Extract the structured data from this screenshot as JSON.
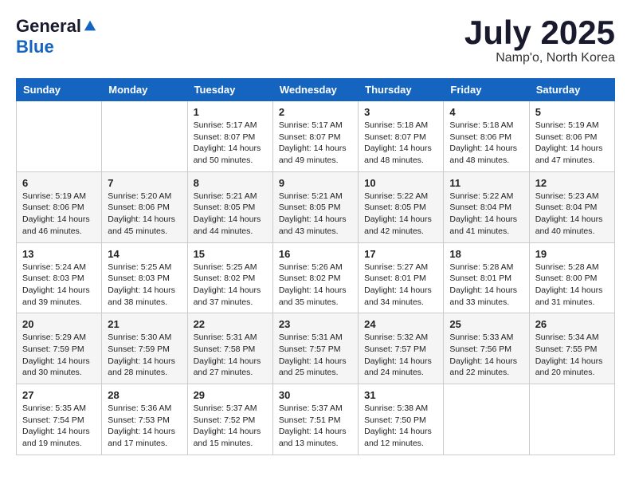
{
  "header": {
    "logo_line1": "General",
    "logo_line2": "Blue",
    "month_title": "July 2025",
    "location": "Namp'o, North Korea"
  },
  "weekdays": [
    "Sunday",
    "Monday",
    "Tuesday",
    "Wednesday",
    "Thursday",
    "Friday",
    "Saturday"
  ],
  "weeks": [
    [
      {
        "day": "",
        "content": ""
      },
      {
        "day": "",
        "content": ""
      },
      {
        "day": "1",
        "content": "Sunrise: 5:17 AM\nSunset: 8:07 PM\nDaylight: 14 hours and 50 minutes."
      },
      {
        "day": "2",
        "content": "Sunrise: 5:17 AM\nSunset: 8:07 PM\nDaylight: 14 hours and 49 minutes."
      },
      {
        "day": "3",
        "content": "Sunrise: 5:18 AM\nSunset: 8:07 PM\nDaylight: 14 hours and 48 minutes."
      },
      {
        "day": "4",
        "content": "Sunrise: 5:18 AM\nSunset: 8:06 PM\nDaylight: 14 hours and 48 minutes."
      },
      {
        "day": "5",
        "content": "Sunrise: 5:19 AM\nSunset: 8:06 PM\nDaylight: 14 hours and 47 minutes."
      }
    ],
    [
      {
        "day": "6",
        "content": "Sunrise: 5:19 AM\nSunset: 8:06 PM\nDaylight: 14 hours and 46 minutes."
      },
      {
        "day": "7",
        "content": "Sunrise: 5:20 AM\nSunset: 8:06 PM\nDaylight: 14 hours and 45 minutes."
      },
      {
        "day": "8",
        "content": "Sunrise: 5:21 AM\nSunset: 8:05 PM\nDaylight: 14 hours and 44 minutes."
      },
      {
        "day": "9",
        "content": "Sunrise: 5:21 AM\nSunset: 8:05 PM\nDaylight: 14 hours and 43 minutes."
      },
      {
        "day": "10",
        "content": "Sunrise: 5:22 AM\nSunset: 8:05 PM\nDaylight: 14 hours and 42 minutes."
      },
      {
        "day": "11",
        "content": "Sunrise: 5:22 AM\nSunset: 8:04 PM\nDaylight: 14 hours and 41 minutes."
      },
      {
        "day": "12",
        "content": "Sunrise: 5:23 AM\nSunset: 8:04 PM\nDaylight: 14 hours and 40 minutes."
      }
    ],
    [
      {
        "day": "13",
        "content": "Sunrise: 5:24 AM\nSunset: 8:03 PM\nDaylight: 14 hours and 39 minutes."
      },
      {
        "day": "14",
        "content": "Sunrise: 5:25 AM\nSunset: 8:03 PM\nDaylight: 14 hours and 38 minutes."
      },
      {
        "day": "15",
        "content": "Sunrise: 5:25 AM\nSunset: 8:02 PM\nDaylight: 14 hours and 37 minutes."
      },
      {
        "day": "16",
        "content": "Sunrise: 5:26 AM\nSunset: 8:02 PM\nDaylight: 14 hours and 35 minutes."
      },
      {
        "day": "17",
        "content": "Sunrise: 5:27 AM\nSunset: 8:01 PM\nDaylight: 14 hours and 34 minutes."
      },
      {
        "day": "18",
        "content": "Sunrise: 5:28 AM\nSunset: 8:01 PM\nDaylight: 14 hours and 33 minutes."
      },
      {
        "day": "19",
        "content": "Sunrise: 5:28 AM\nSunset: 8:00 PM\nDaylight: 14 hours and 31 minutes."
      }
    ],
    [
      {
        "day": "20",
        "content": "Sunrise: 5:29 AM\nSunset: 7:59 PM\nDaylight: 14 hours and 30 minutes."
      },
      {
        "day": "21",
        "content": "Sunrise: 5:30 AM\nSunset: 7:59 PM\nDaylight: 14 hours and 28 minutes."
      },
      {
        "day": "22",
        "content": "Sunrise: 5:31 AM\nSunset: 7:58 PM\nDaylight: 14 hours and 27 minutes."
      },
      {
        "day": "23",
        "content": "Sunrise: 5:31 AM\nSunset: 7:57 PM\nDaylight: 14 hours and 25 minutes."
      },
      {
        "day": "24",
        "content": "Sunrise: 5:32 AM\nSunset: 7:57 PM\nDaylight: 14 hours and 24 minutes."
      },
      {
        "day": "25",
        "content": "Sunrise: 5:33 AM\nSunset: 7:56 PM\nDaylight: 14 hours and 22 minutes."
      },
      {
        "day": "26",
        "content": "Sunrise: 5:34 AM\nSunset: 7:55 PM\nDaylight: 14 hours and 20 minutes."
      }
    ],
    [
      {
        "day": "27",
        "content": "Sunrise: 5:35 AM\nSunset: 7:54 PM\nDaylight: 14 hours and 19 minutes."
      },
      {
        "day": "28",
        "content": "Sunrise: 5:36 AM\nSunset: 7:53 PM\nDaylight: 14 hours and 17 minutes."
      },
      {
        "day": "29",
        "content": "Sunrise: 5:37 AM\nSunset: 7:52 PM\nDaylight: 14 hours and 15 minutes."
      },
      {
        "day": "30",
        "content": "Sunrise: 5:37 AM\nSunset: 7:51 PM\nDaylight: 14 hours and 13 minutes."
      },
      {
        "day": "31",
        "content": "Sunrise: 5:38 AM\nSunset: 7:50 PM\nDaylight: 14 hours and 12 minutes."
      },
      {
        "day": "",
        "content": ""
      },
      {
        "day": "",
        "content": ""
      }
    ]
  ]
}
